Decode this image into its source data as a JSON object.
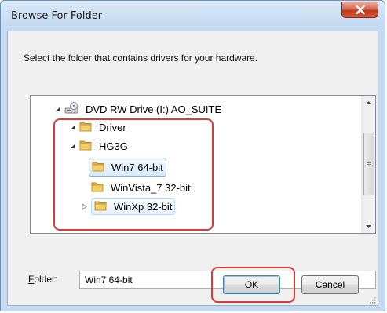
{
  "window": {
    "title": "Browse For Folder",
    "close_glyph": "X"
  },
  "dialog": {
    "instruction": "Select the folder that contains drivers for your hardware."
  },
  "tree": {
    "nodes": [
      {
        "label": "DVD RW Drive (I:) AO_SUITE",
        "icon": "drive-icon",
        "state": "expanded"
      },
      {
        "label": "Driver",
        "icon": "folder-icon",
        "state": "expanded"
      },
      {
        "label": "HG3G",
        "icon": "folder-icon",
        "state": "expanded"
      },
      {
        "label": "Win7 64-bit",
        "icon": "folder-icon",
        "state": "selected"
      },
      {
        "label": "WinVista_7 32-bit",
        "icon": "folder-icon",
        "state": "leaf"
      },
      {
        "label": "WinXp 32-bit",
        "icon": "folder-icon",
        "state": "collapsed"
      }
    ]
  },
  "folder": {
    "label_prefix": "F",
    "label_rest": "older:",
    "value": "Win7 64-bit"
  },
  "buttons": {
    "ok": "OK",
    "cancel": "Cancel"
  },
  "colors": {
    "highlight": "#d83a3a",
    "selection": "#d8eaf9",
    "close_button": "#c0391c"
  }
}
